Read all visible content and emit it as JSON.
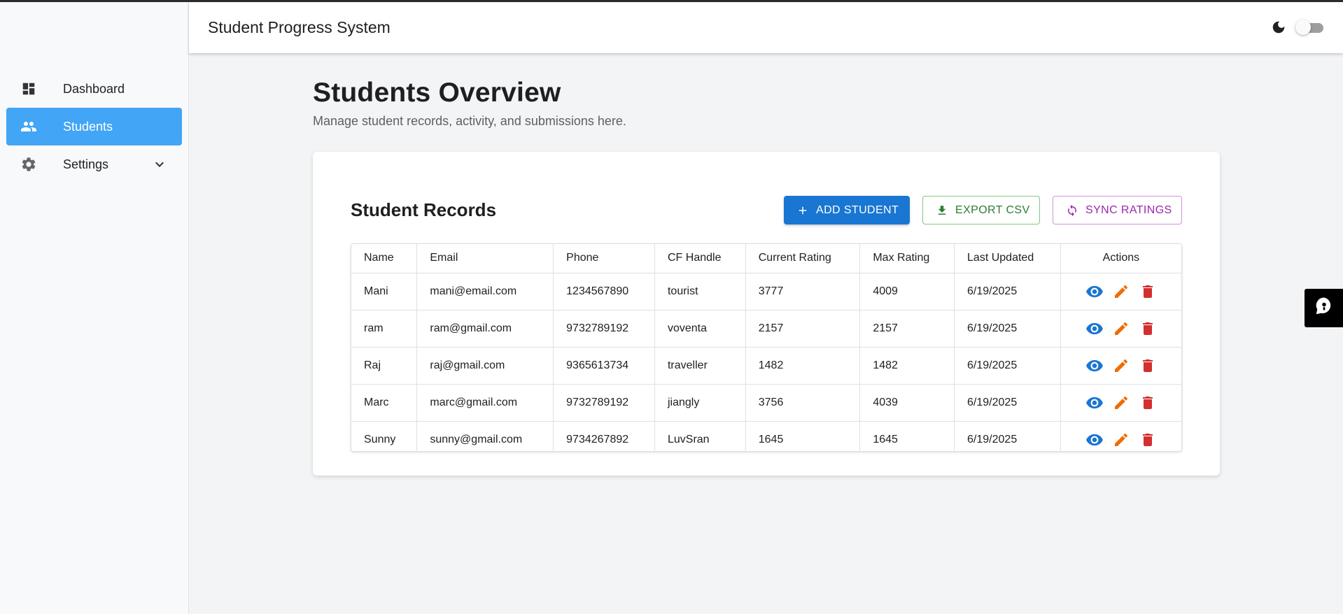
{
  "header": {
    "title": "Student Progress System"
  },
  "sidebar": {
    "items": [
      {
        "label": "Dashboard",
        "icon": "dashboard-icon"
      },
      {
        "label": "Students",
        "icon": "people-icon",
        "active": true
      },
      {
        "label": "Settings",
        "icon": "gear-icon",
        "expandable": true
      }
    ]
  },
  "page": {
    "title": "Students Overview",
    "subtitle": "Manage student records, activity, and submissions here."
  },
  "card": {
    "title": "Student Records",
    "add_label": "ADD STUDENT",
    "export_label": "EXPORT CSV",
    "sync_label": "SYNC RATINGS"
  },
  "table": {
    "columns": [
      "Name",
      "Email",
      "Phone",
      "CF Handle",
      "Current Rating",
      "Max Rating",
      "Last Updated",
      "Actions"
    ],
    "rows": [
      [
        "Mani",
        "mani@email.com",
        "1234567890",
        "tourist",
        "3777",
        "4009",
        "6/19/2025"
      ],
      [
        "ram",
        "ram@gmail.com",
        "9732789192",
        "voventa",
        "2157",
        "2157",
        "6/19/2025"
      ],
      [
        "Raj",
        "raj@gmail.com",
        "9365613734",
        "traveller",
        "1482",
        "1482",
        "6/19/2025"
      ],
      [
        "Marc",
        "marc@gmail.com",
        "9732789192",
        "jiangly",
        "3756",
        "4039",
        "6/19/2025"
      ],
      [
        "Sunny",
        "sunny@gmail.com",
        "9734267892",
        "LuvSran",
        "1645",
        "1645",
        "6/19/2025"
      ]
    ]
  },
  "colors": {
    "primary": "#1976d2",
    "active_nav": "#42a5f5",
    "export": "#2e7d32",
    "sync": "#9c27b0",
    "view_icon": "#1976d2",
    "edit_icon": "#ef6c00",
    "delete_icon": "#d32f2f"
  }
}
